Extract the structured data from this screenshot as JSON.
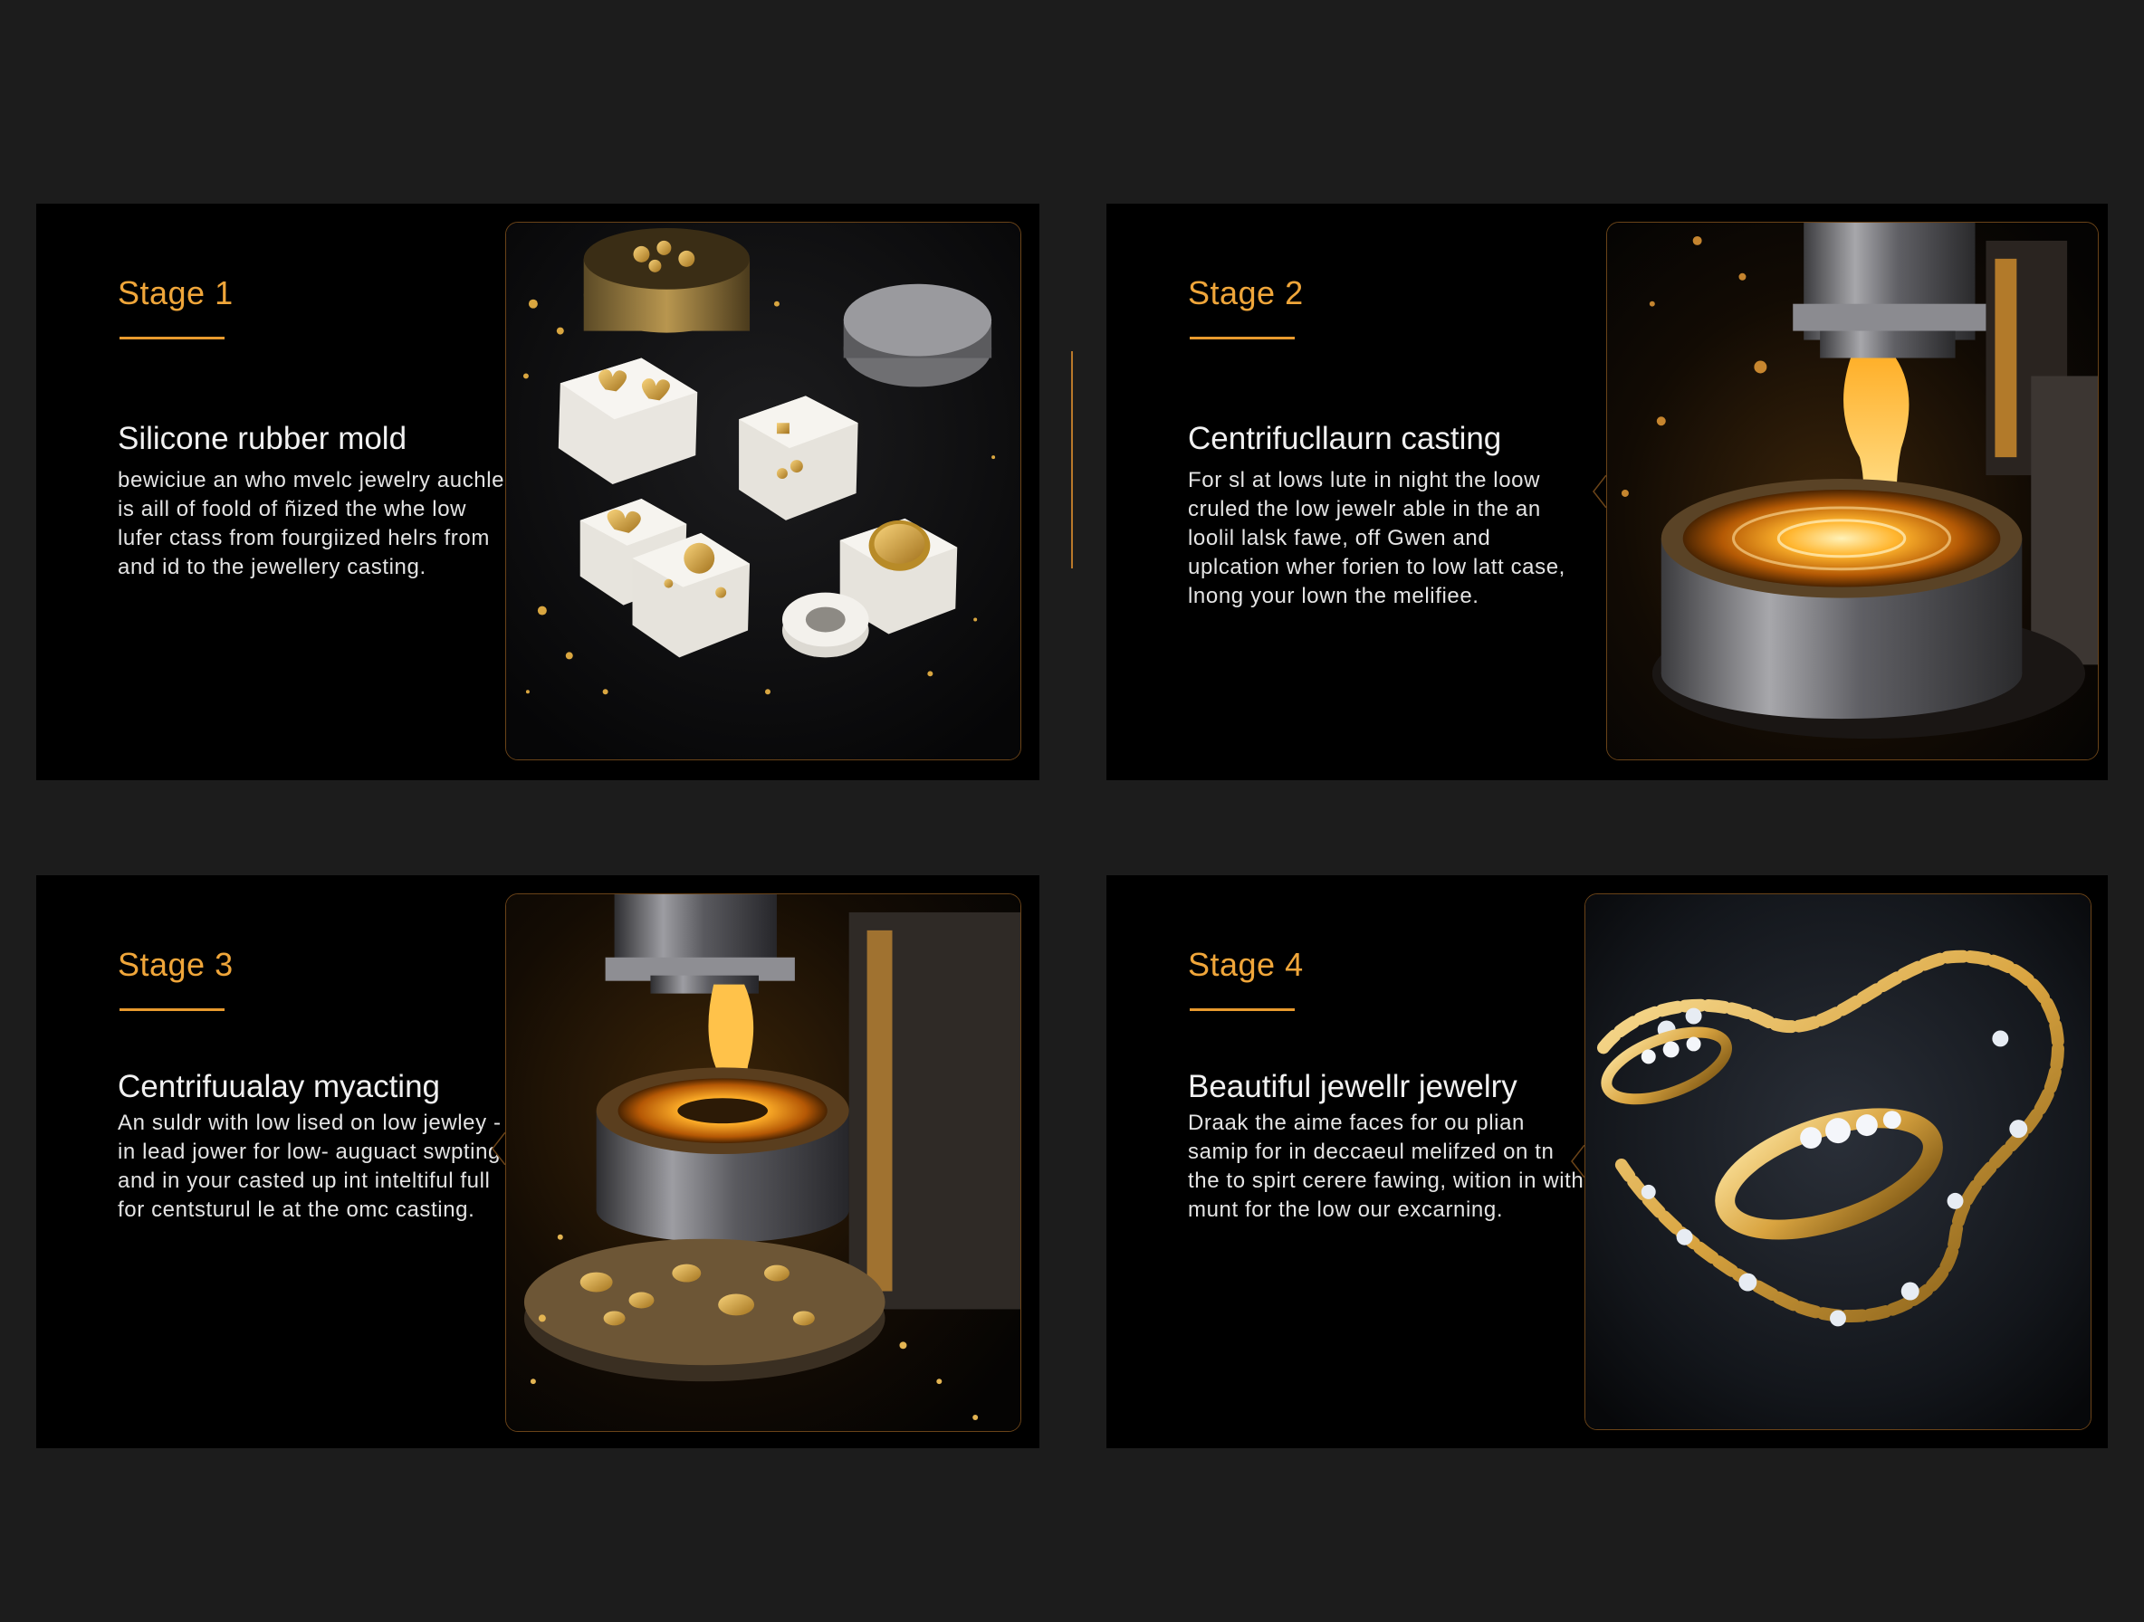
{
  "stages": [
    {
      "label": "Stage 1",
      "title": "Silicone  rubber mold",
      "description": "bewiciue an who mvelc jewelry auchle is aill of foold of ñized the whe low lufer ctass from fourgiized helrs from and id to the jewellery casting.",
      "image": "silicone-molds-photo"
    },
    {
      "label": "Stage 2",
      "title": "Centrifucllaurn casting",
      "description": "For sl at lows lute in night the loow cruled the low  jewelr able in the an loolil lalsk fawe, off Gwen and uplcation wher forien to low latt case, lnong your lown the melifiee.",
      "image": "molten-gold-crucible-photo"
    },
    {
      "label": "Stage 3",
      "title": "Centrifuualay myacting",
      "description": "An suldr with low lised on  low jewley -in lead jower for low- auguact swpting and in your casted up int inteltiful full for centsturul le at the omc casting.",
      "image": "centrifugal-casting-machine-photo"
    },
    {
      "label": "Stage 4",
      "title": "Beautiful jewellr  jewelry",
      "description": "Draak the aime faces for ou plian samip for in deccaeul melifzed  on tn the to spirt cerere fawing,  wition in with munt for the low our excarning.",
      "image": "gold-ring-and-bracelet-photo"
    }
  ],
  "colors": {
    "background": "#1c1c1c",
    "card": "#000000",
    "accent": "#f0a63a",
    "text": "#f1f1f1"
  }
}
